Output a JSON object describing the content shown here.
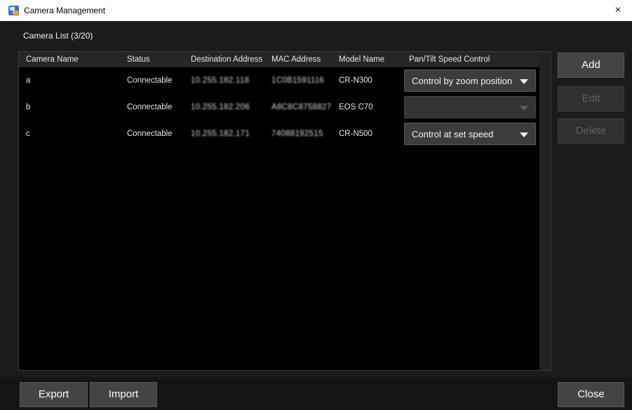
{
  "window": {
    "title": "Camera Management",
    "app_icon": "camera-management-app-icon",
    "close_glyph": "×"
  },
  "camera_list": {
    "label": "Camera List  (3/20)",
    "columns": [
      "Camera Name",
      "Status",
      "Destination Address",
      "MAC Address",
      "Model Name",
      "Pan/Tilt Speed Control"
    ],
    "rows": [
      {
        "name": "a",
        "status": "Connectable",
        "destination": "10.255.182.118",
        "mac": "1C0B1591116",
        "model": "CR-N300",
        "pan_tilt": "Control by zoom position",
        "pan_tilt_enabled": true
      },
      {
        "name": "b",
        "status": "Connectable",
        "destination": "10.255.182.206",
        "mac": "A8C8C8758827",
        "model": "EOS C70",
        "pan_tilt": "",
        "pan_tilt_enabled": false
      },
      {
        "name": "c",
        "status": "Connectable",
        "destination": "10.255.182.171",
        "mac": "74088192515",
        "model": "CR-N500",
        "pan_tilt": "Control at set speed",
        "pan_tilt_enabled": true
      }
    ]
  },
  "actions": {
    "add": "Add",
    "edit": "Edit",
    "delete": "Delete",
    "export": "Export",
    "import": "Import",
    "close": "Close"
  },
  "colors": {
    "background": "#1b1b1b",
    "table_background": "#000000",
    "button": "#444444",
    "disabled_text": "#5e5e5e"
  }
}
